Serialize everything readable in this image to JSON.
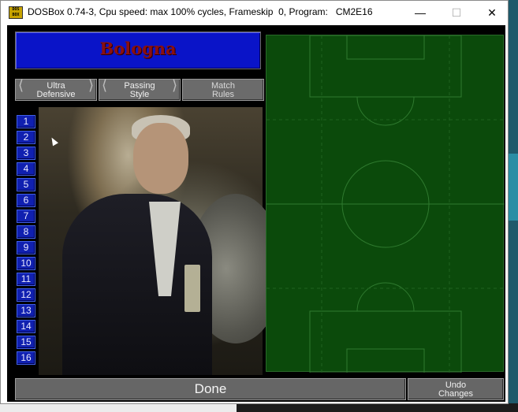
{
  "window": {
    "title": "DOSBox 0.74-3, Cpu speed: max 100% cycles, Frameskip  0, Program:   CM2E16",
    "icon_text": "DOS BOX",
    "minimize_icon": "minimize-icon",
    "maximize_icon": "maximize-icon",
    "close_icon": "close-icon"
  },
  "team": {
    "name": "Bologna"
  },
  "tabs": [
    {
      "line1": "Ultra",
      "line2": "Defensive",
      "left_arrow": "⟨",
      "right_arrow": "⟩"
    },
    {
      "line1": "Passing",
      "line2": "Style",
      "left_arrow": "⟨",
      "right_arrow": "⟩"
    },
    {
      "line1": "Match",
      "line2": "Rules"
    }
  ],
  "player_numbers": [
    "1",
    "2",
    "3",
    "4",
    "5",
    "6",
    "7",
    "8",
    "9",
    "10",
    "11",
    "12",
    "13",
    "14",
    "15",
    "16"
  ],
  "pitch": {
    "color": "#0b4a0b",
    "line_color": "#2f7a2f"
  },
  "buttons": {
    "done": "Done",
    "undo_line1": "Undo",
    "undo_line2": "Changes"
  },
  "colors": {
    "banner": "#0a14c8",
    "team_name": "#8a1010",
    "number_button": "#1020b0",
    "gray_button": "#666666"
  }
}
